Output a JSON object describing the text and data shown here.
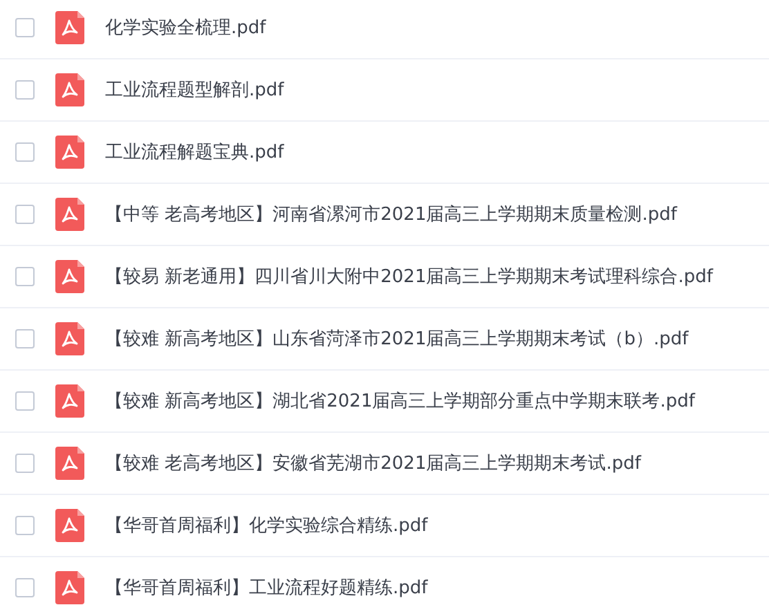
{
  "files": [
    {
      "name": "化学实验全梳理.pdf",
      "checked": false
    },
    {
      "name": "工业流程题型解剖.pdf",
      "checked": false
    },
    {
      "name": "工业流程解题宝典.pdf",
      "checked": false
    },
    {
      "name": "【中等 老高考地区】河南省漯河市2021届高三上学期期末质量检测.pdf",
      "checked": false
    },
    {
      "name": "【较易 新老通用】四川省川大附中2021届高三上学期期末考试理科综合.pdf",
      "checked": false
    },
    {
      "name": "【较难 新高考地区】山东省菏泽市2021届高三上学期期末考试（b）.pdf",
      "checked": false
    },
    {
      "name": "【较难 新高考地区】湖北省2021届高三上学期部分重点中学期末联考.pdf",
      "checked": false
    },
    {
      "name": "【较难 老高考地区】安徽省芜湖市2021届高三上学期期末考试.pdf",
      "checked": false
    },
    {
      "name": "【华哥首周福利】化学实验综合精练.pdf",
      "checked": false
    },
    {
      "name": "【华哥首周福利】工业流程好题精练.pdf",
      "checked": false
    }
  ]
}
